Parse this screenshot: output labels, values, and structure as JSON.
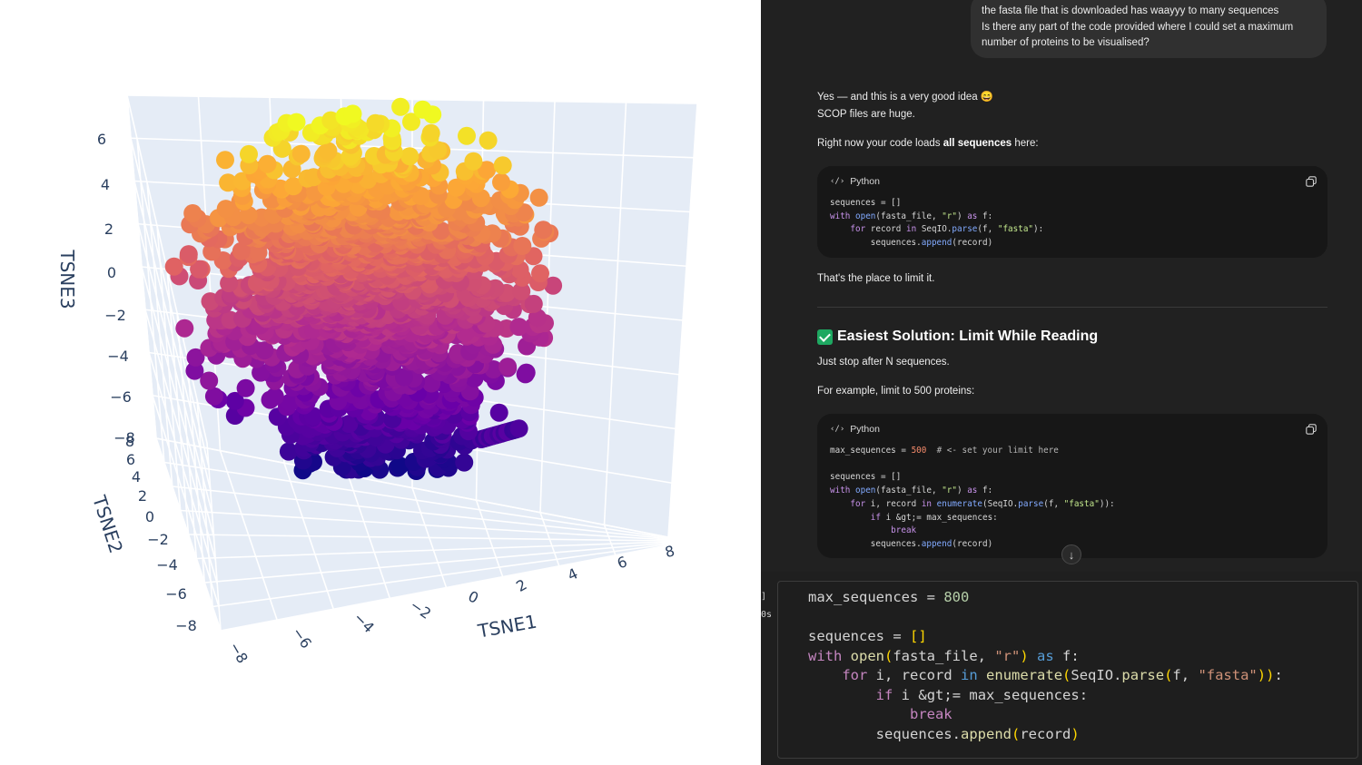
{
  "plot": {
    "axes": {
      "x_title": "TSNE1",
      "y_title": "TSNE2",
      "z_title": "TSNE3"
    },
    "z_ticks": [
      "6",
      "4",
      "2",
      "0",
      "−2",
      "−4",
      "−6",
      "−8"
    ],
    "y_ticks": [
      "8",
      "6",
      "4",
      "2",
      "0",
      "−2",
      "−4",
      "−6",
      "−8"
    ],
    "x_ticks": [
      "−8",
      "−6",
      "−4",
      "−2",
      "0",
      "2",
      "4",
      "6",
      "8"
    ],
    "colorscale": [
      "#0d0887",
      "#6a00a8",
      "#b12a90",
      "#e16462",
      "#fca636",
      "#f0f921"
    ],
    "background_color": "#e5ecf6"
  },
  "chat": {
    "user_message": {
      "line1": "the fasta file that is downloaded has waayyy to many sequences",
      "line2": "Is there any part of the code provided where I could set a maximum",
      "line3": "number of proteins to be visualised?"
    },
    "reply": {
      "p1": "Yes — and this is a very good idea 😄",
      "p2": "SCOP files are huge.",
      "p3_pre": "Right now your code loads ",
      "p3_bold": "all sequences",
      "p3_post": " here:",
      "p4": "That's the place to limit it.",
      "heading": "Easiest Solution: Limit While Reading",
      "p5": "Just stop after N sequences.",
      "p6": "For example, limit to 500 proteins:"
    },
    "code_block_1": {
      "lang": "Python",
      "lines": [
        "sequences = []",
        "with open(fasta_file, \"r\") as f:",
        "    for record in SeqIO.parse(f, \"fasta\"):",
        "        sequences.append(record)"
      ]
    },
    "code_block_2": {
      "lang": "Python",
      "lines": [
        "max_sequences = 500  # <- set your limit here",
        "",
        "sequences = []",
        "with open(fasta_file, \"r\") as f:",
        "    for i, record in enumerate(SeqIO.parse(f, \"fasta\")):",
        "        if i >= max_sequences:",
        "            break",
        "        sequences.append(record)"
      ]
    }
  },
  "notebook_cell": {
    "gutter": [
      "]",
      "0s"
    ],
    "lines": [
      "max_sequences = 800",
      "",
      "sequences = []",
      "with open(fasta_file, \"r\") as f:",
      "    for i, record in enumerate(SeqIO.parse(f, \"fasta\")):",
      "        if i >= max_sequences:",
      "            break",
      "        sequences.append(record)"
    ]
  }
}
